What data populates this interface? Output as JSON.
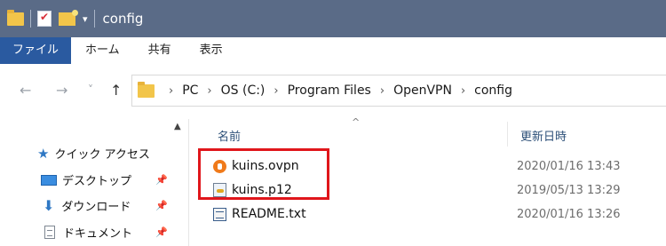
{
  "window": {
    "title": "config"
  },
  "quick_access_toolbar": {
    "icons": [
      "folder-icon",
      "properties-icon",
      "new-folder-icon"
    ],
    "dropdown_glyph": "▾"
  },
  "ribbon": {
    "tabs": [
      "ファイル",
      "ホーム",
      "共有",
      "表示"
    ]
  },
  "navigation": {
    "back": "←",
    "forward": "→",
    "recent": "˅",
    "up": "↑"
  },
  "address_bar": {
    "separator": "›",
    "crumbs": [
      "PC",
      "OS (C:)",
      "Program Files",
      "OpenVPN",
      "config"
    ]
  },
  "nav_pane": {
    "scroll_up": "▲",
    "pin_glyph": "📌",
    "quick_access": "クイック アクセス",
    "items": [
      "デスクトップ",
      "ダウンロード",
      "ドキュメント"
    ]
  },
  "file_list": {
    "sort_indicator": "^",
    "columns": {
      "name": "名前",
      "modified": "更新日時"
    },
    "rows": [
      {
        "name": "kuins.ovpn",
        "modified": "2020/01/16 13:43",
        "icon": "openvpn-config-icon"
      },
      {
        "name": "kuins.p12",
        "modified": "2019/05/13 13:29",
        "icon": "certificate-icon"
      },
      {
        "name": "README.txt",
        "modified": "2020/01/16 13:26",
        "icon": "text-file-icon"
      }
    ]
  },
  "colors": {
    "title_bar": "#5a6b87",
    "file_tab": "#2a5aa0",
    "highlight": "#e0161b"
  }
}
